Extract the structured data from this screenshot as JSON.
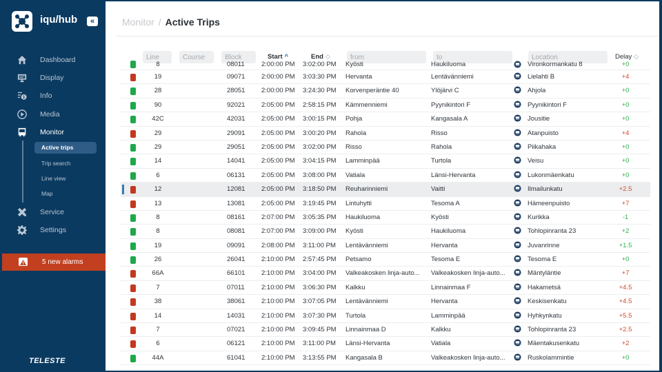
{
  "app": {
    "brand": "iqu/hub",
    "collapse_icon": "«",
    "footer_logo": "TELESTE"
  },
  "sidebar": {
    "items": [
      {
        "label": "Dashboard",
        "icon": "home-icon"
      },
      {
        "label": "Display",
        "icon": "display-icon"
      },
      {
        "label": "Info",
        "icon": "info-icon"
      },
      {
        "label": "Media",
        "icon": "play-icon"
      },
      {
        "label": "Monitor",
        "icon": "bus-icon",
        "active": true
      },
      {
        "label": "Service",
        "icon": "tools-icon"
      },
      {
        "label": "Settings",
        "icon": "gear-icon"
      }
    ],
    "monitor_sub": [
      {
        "label": "Active trips",
        "active": true
      },
      {
        "label": "Trip search"
      },
      {
        "label": "Line view"
      },
      {
        "label": "Map"
      }
    ],
    "alarm": {
      "label": "5 new alarms",
      "icon": "warning-icon"
    }
  },
  "breadcrumb": {
    "parent": "Monitor",
    "separator": "/",
    "current": "Active Trips"
  },
  "filters": {
    "line_placeholder": "Line",
    "course_placeholder": "Course",
    "block_placeholder": "Block",
    "start_label": "Start",
    "start_sort": "^",
    "end_label": "End",
    "end_sort": "◇",
    "from_placeholder": "from",
    "to_placeholder": "to",
    "location_placeholder": "Location",
    "delay_label": "Delay",
    "delay_sort": "◇"
  },
  "colors": {
    "status_ok": "#1fa84a",
    "status_late": "#c2391f",
    "delay_ok": "#2fb14a",
    "delay_late": "#d24a2e",
    "sidebar_bg": "#0b3a60",
    "alarm_bg": "#c2401f",
    "selected_marker": "#3a78b0"
  },
  "trips": [
    {
      "status": "ok",
      "line": "8",
      "block": "08011",
      "start": "2:00:00 PM",
      "end": "3:02:00 PM",
      "from": "Kyösti",
      "to": "Haukiluoma",
      "location": "Vironkormankatu 8",
      "delay": "+0",
      "clipped": true
    },
    {
      "status": "late",
      "line": "19",
      "block": "09071",
      "start": "2:00:00 PM",
      "end": "3:03:30 PM",
      "from": "Hervanta",
      "to": "Lentävänniemi",
      "location": "Lielahti B",
      "delay": "+4"
    },
    {
      "status": "ok",
      "line": "28",
      "block": "28051",
      "start": "2:00:00 PM",
      "end": "3:24:30 PM",
      "from": "Korvenperäntie 40",
      "to": "Ylöjärvi C",
      "location": "Ahjola",
      "delay": "+0"
    },
    {
      "status": "ok",
      "line": "90",
      "block": "92021",
      "start": "2:05:00 PM",
      "end": "2:58:15 PM",
      "from": "Kämmenniemi",
      "to": "Pyynikintori F",
      "location": "Pyynikintori F",
      "delay": "+0"
    },
    {
      "status": "ok",
      "line": "42C",
      "block": "42031",
      "start": "2:05:00 PM",
      "end": "3:00:15 PM",
      "from": "Pohja",
      "to": "Kangasala A",
      "location": "Jousitie",
      "delay": "+0"
    },
    {
      "status": "late",
      "line": "29",
      "block": "29091",
      "start": "2:05:00 PM",
      "end": "3:00:20 PM",
      "from": "Rahola",
      "to": "Risso",
      "location": "Atanpuisto",
      "delay": "+4"
    },
    {
      "status": "ok",
      "line": "29",
      "block": "29051",
      "start": "2:05:00 PM",
      "end": "3:02:00 PM",
      "from": "Risso",
      "to": "Rahola",
      "location": "Piikahaka",
      "delay": "+0"
    },
    {
      "status": "ok",
      "line": "14",
      "block": "14041",
      "start": "2:05:00 PM",
      "end": "3:04:15 PM",
      "from": "Lamminpää",
      "to": "Turtola",
      "location": "Veisu",
      "delay": "+0"
    },
    {
      "status": "ok",
      "line": "6",
      "block": "06131",
      "start": "2:05:00 PM",
      "end": "3:08:00 PM",
      "from": "Vatiala",
      "to": "Länsi-Hervanta",
      "location": "Lukonmäenkatu",
      "delay": "+0"
    },
    {
      "status": "late",
      "line": "12",
      "block": "12081",
      "start": "2:05:00 PM",
      "end": "3:18:50 PM",
      "from": "Reuharinniemi",
      "to": "Vaitti",
      "location": "Ilmailunkatu",
      "delay": "+2.5",
      "selected": true
    },
    {
      "status": "late",
      "line": "13",
      "block": "13081",
      "start": "2:05:00 PM",
      "end": "3:19:45 PM",
      "from": "Lintuhytti",
      "to": "Tesoma A",
      "location": "Hämeenpuisto",
      "delay": "+7"
    },
    {
      "status": "ok",
      "line": "8",
      "block": "08161",
      "start": "2:07:00 PM",
      "end": "3:05:35 PM",
      "from": "Haukiluoma",
      "to": "Kyösti",
      "location": "Kurikka",
      "delay": "-1"
    },
    {
      "status": "ok",
      "line": "8",
      "block": "08081",
      "start": "2:07:00 PM",
      "end": "3:09:00 PM",
      "from": "Kyösti",
      "to": "Haukiluoma",
      "location": "Tohlopinranta 23",
      "delay": "+2"
    },
    {
      "status": "ok",
      "line": "19",
      "block": "09091",
      "start": "2:08:00 PM",
      "end": "3:11:00 PM",
      "from": "Lentävänniemi",
      "to": "Hervanta",
      "location": "Juvanrinne",
      "delay": "+1.5"
    },
    {
      "status": "ok",
      "line": "26",
      "block": "26041",
      "start": "2:10:00 PM",
      "end": "2:57:45 PM",
      "from": "Petsamo",
      "to": "Tesoma E",
      "location": "Tesoma E",
      "delay": "+0"
    },
    {
      "status": "late",
      "line": "66A",
      "block": "66101",
      "start": "2:10:00 PM",
      "end": "3:04:00 PM",
      "from": "Valkeakosken linja-auto...",
      "to": "Valkeakosken linja-auto...",
      "location": "Mäntyläntie",
      "delay": "+7"
    },
    {
      "status": "late",
      "line": "7",
      "block": "07011",
      "start": "2:10:00 PM",
      "end": "3:06:30 PM",
      "from": "Kalkku",
      "to": "Linnainmaa F",
      "location": "Hakametsä",
      "delay": "+4.5"
    },
    {
      "status": "late",
      "line": "38",
      "block": "38061",
      "start": "2:10:00 PM",
      "end": "3:07:05 PM",
      "from": "Lentävänniemi",
      "to": "Hervanta",
      "location": "Keskisenkatu",
      "delay": "+4.5"
    },
    {
      "status": "late",
      "line": "14",
      "block": "14031",
      "start": "2:10:00 PM",
      "end": "3:07:30 PM",
      "from": "Turtola",
      "to": "Lamminpää",
      "location": "Hyhkynkatu",
      "delay": "+5.5"
    },
    {
      "status": "late",
      "line": "7",
      "block": "07021",
      "start": "2:10:00 PM",
      "end": "3:09:45 PM",
      "from": "Linnainmaa D",
      "to": "Kalkku",
      "location": "Tohlopinranta 23",
      "delay": "+2.5"
    },
    {
      "status": "late",
      "line": "6",
      "block": "06121",
      "start": "2:10:00 PM",
      "end": "3:11:00 PM",
      "from": "Länsi-Hervanta",
      "to": "Vatiala",
      "location": "Mäentakusenkatu",
      "delay": "+2"
    },
    {
      "status": "ok",
      "line": "44A",
      "block": "61041",
      "start": "2:10:00 PM",
      "end": "3:13:55 PM",
      "from": "Kangasala B",
      "to": "Valkeakosken linja-auto...",
      "location": "Ruskolammintie",
      "delay": "+0"
    }
  ]
}
